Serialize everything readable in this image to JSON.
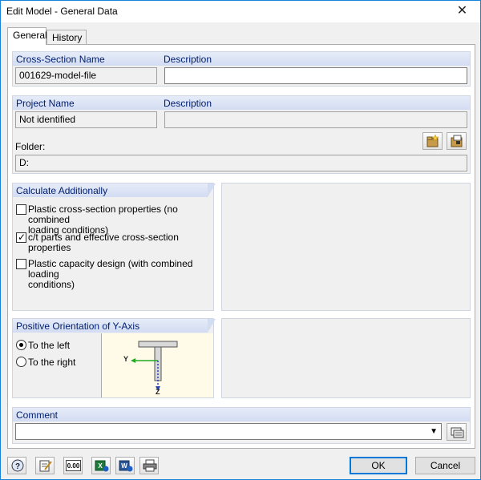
{
  "window": {
    "title": "Edit Model - General Data",
    "close_glyph": "✕"
  },
  "tabs": [
    {
      "label": "General",
      "active": true
    },
    {
      "label": "History",
      "active": false
    }
  ],
  "cross_section": {
    "header": "Cross-Section Name",
    "description_header": "Description",
    "name_value": "001629-model-file",
    "description_value": ""
  },
  "project": {
    "header": "Project Name",
    "description_header": "Description",
    "name_value": "Not identified",
    "description_value": "",
    "folder_label": "Folder:",
    "folder_value": "D:",
    "new_folder_icon": "new-folder-icon",
    "open_folder_icon": "open-folder-icon"
  },
  "calculate": {
    "header": "Calculate Additionally",
    "options": [
      {
        "label_line1": "Plastic cross-section properties (no combined",
        "label_line2": "loading conditions)",
        "checked": false
      },
      {
        "label_line1": "c/t parts and effective cross-section properties",
        "label_line2": "",
        "checked": true
      },
      {
        "label_line1": "Plastic capacity design (with combined loading",
        "label_line2": "conditions)",
        "checked": false
      }
    ]
  },
  "orientation": {
    "header": "Positive Orientation of Y-Axis",
    "options": [
      {
        "label": "To the left",
        "selected": true
      },
      {
        "label": "To the right",
        "selected": false
      }
    ],
    "diagram": {
      "y_axis_label": "Y",
      "z_axis_label": "Z",
      "y_color": "#22aa22",
      "z_color": "#2b3fae"
    }
  },
  "comment": {
    "header": "Comment",
    "value": "",
    "library_icon": "comment-library-icon"
  },
  "footer": {
    "tool_icons": [
      "help-icon",
      "edit-icon",
      "units-icon",
      "export-excel-icon",
      "import-icon",
      "print-icon"
    ],
    "units_text": "0.00",
    "ok_label": "OK",
    "cancel_label": "Cancel"
  },
  "colors": {
    "header_text": "#001e6e",
    "accent": "#0078d7"
  }
}
